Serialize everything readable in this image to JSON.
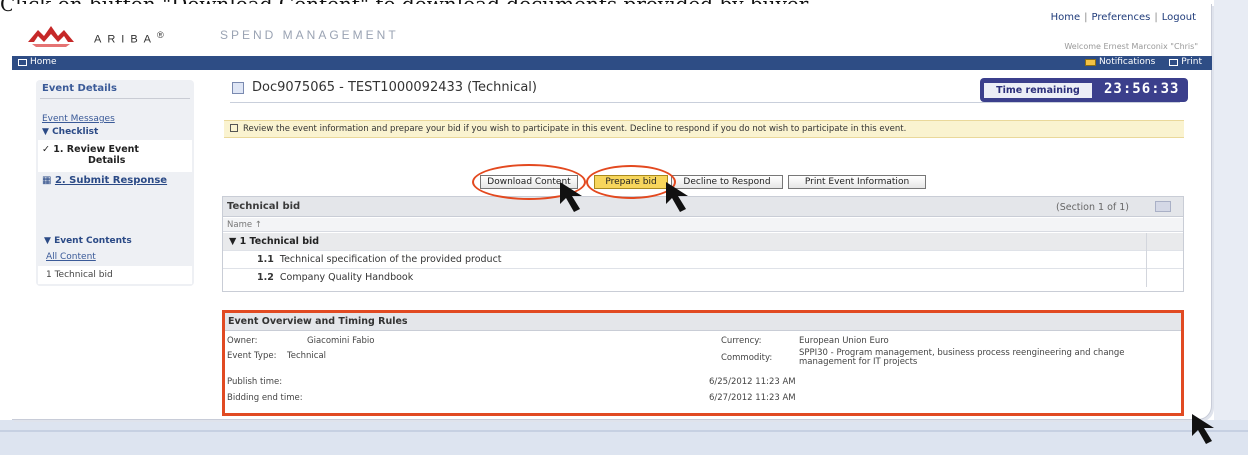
{
  "caption": "Click on button \"Download Content\" to download documents provided by buyer.",
  "header": {
    "brand": "ARIBA",
    "brand_suffix": "®",
    "tagline": "SPEND MANAGEMENT",
    "links": [
      "Home",
      "Preferences",
      "Logout"
    ],
    "welcome": "Welcome Ernest Marconix \"Chris\""
  },
  "navbar": {
    "home": "Home",
    "notifications": "Notifications",
    "print": "Print"
  },
  "sidebar": {
    "title": "Event Details",
    "event_messages": "Event Messages",
    "checklist": "Checklist",
    "step1": "1. Review Event",
    "step1b": "Details",
    "step2": "2. Submit Response",
    "event_contents": "Event Contents",
    "all_content": "All Content",
    "item": "1  Technical bid"
  },
  "doc": {
    "title": "Doc9075065 - TEST1000092433 (Technical)"
  },
  "timer": {
    "label": "Time remaining",
    "value": "23:56:33"
  },
  "notice": "Review the event information and prepare your bid if you wish to participate in this event.  Decline to respond if you do not wish to participate in this event.",
  "buttons": {
    "download": "Download Content",
    "prepare": "Prepare bid",
    "decline": "Decline to Respond",
    "print": "Print Event Information"
  },
  "table": {
    "title": "Technical bid",
    "section": "(Section 1 of 1)",
    "column_name": "Name ↑",
    "group": "▼ 1  Technical bid",
    "rows": [
      {
        "num": "1.1",
        "text": "Technical specification of the provided product"
      },
      {
        "num": "1.2",
        "text": "Company Quality Handbook"
      }
    ]
  },
  "overview": {
    "title": "Event Overview and Timing Rules",
    "owner_label": "Owner:",
    "owner_value": "Giacomini Fabio",
    "type_label": "Event Type:",
    "type_value": "Technical",
    "currency_label": "Currency:",
    "currency_value": "European Union Euro",
    "commodity_label": "Commodity:",
    "commodity_value": "SPPI30 - Program management, business process reengineering and change management for IT projects",
    "publish_label": "Publish time:",
    "publish_value": "6/25/2012 11:23 AM",
    "bidding_label": "Bidding end time:",
    "bidding_value": "6/27/2012 11:23 AM"
  }
}
